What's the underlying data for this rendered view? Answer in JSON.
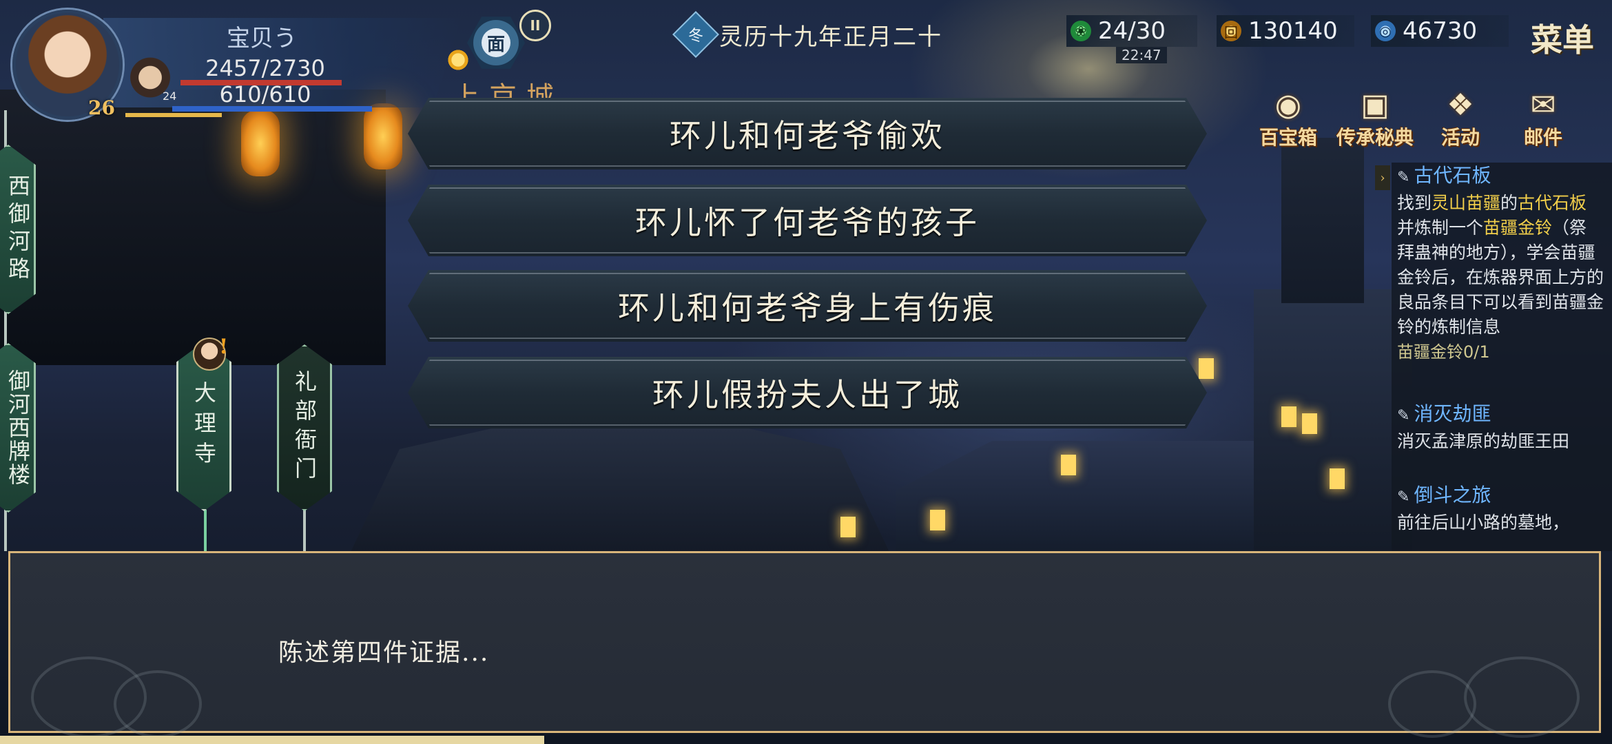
{
  "player": {
    "name": "宝贝う",
    "level": "26",
    "companion_level": "24",
    "hp": "2457/2730",
    "hp_fraction": 0.9,
    "mp": "610/610",
    "mp_fraction": 1.0
  },
  "rank_badge": "面",
  "location": "上京城",
  "calendar": {
    "season_icon": "冬",
    "date": "灵历十九年正月二十"
  },
  "resources": {
    "stamina": "24/30",
    "time": "22:47",
    "coins": "130140",
    "spirit": "46730"
  },
  "menu_label": "菜单",
  "top_icons": [
    {
      "label": "百宝箱",
      "icon": "treasure-box-icon"
    },
    {
      "label": "传承秘典",
      "icon": "scroll-book-icon"
    },
    {
      "label": "活动",
      "icon": "gift-icon"
    },
    {
      "label": "邮件",
      "icon": "mail-icon"
    }
  ],
  "quests": [
    {
      "title": "古代石板",
      "desc_parts": [
        "找到",
        "灵山苗疆",
        "的",
        "古代石板",
        "并炼制一个",
        "苗疆金铃",
        "（祭拜蛊神的地方），学会苗疆金铃后，在炼器界面上方的良品条目下可以看到苗疆金铃的炼制信息"
      ],
      "progress": "苗疆金铃0/1"
    },
    {
      "title": "消灭劫匪",
      "desc": "消灭孟津原的劫匪王田"
    },
    {
      "title": "倒斗之旅",
      "desc": "前往后山小路的墓地，"
    }
  ],
  "signposts": [
    {
      "label": "西御河路"
    },
    {
      "label": "御河西牌楼"
    },
    {
      "label": "大理寺"
    },
    {
      "label": "礼部衙门"
    }
  ],
  "choices": [
    "环儿和何老爷偷欢",
    "环儿怀了何老爷的孩子",
    "环儿和何老爷身上有伤痕",
    "环儿假扮夫人出了城"
  ],
  "dialogue": "陈述第四件证据..."
}
